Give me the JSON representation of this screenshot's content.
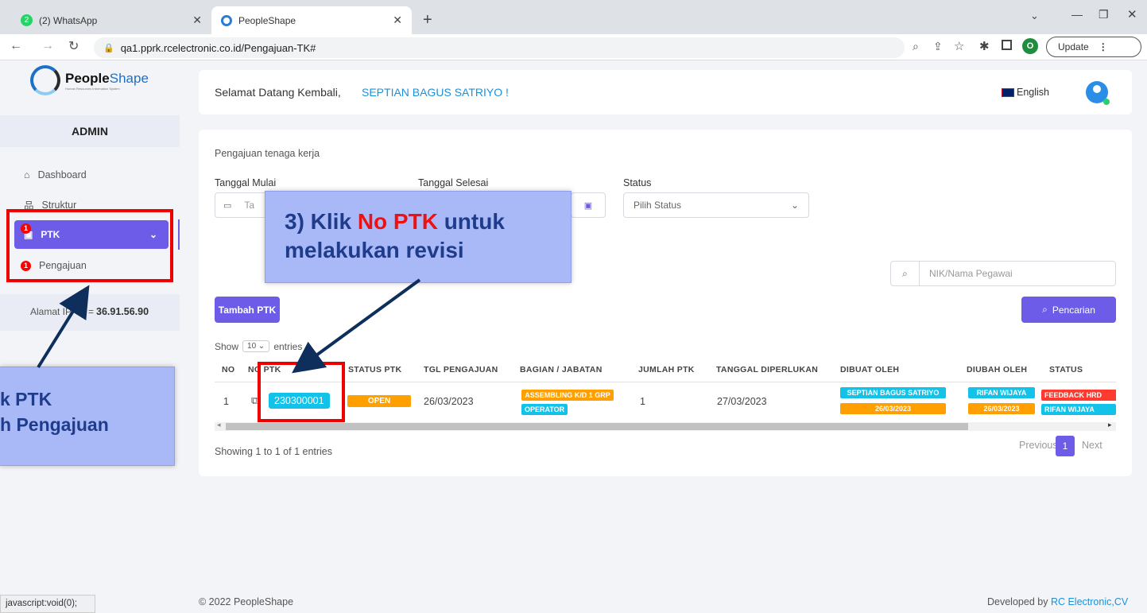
{
  "browser": {
    "tabs": [
      {
        "label": "(2) WhatsApp",
        "badge": "2"
      },
      {
        "label": "PeopleShape"
      }
    ],
    "url": "qa1.pprk.rcelectronic.co.id/Pengajuan-TK#",
    "update_label": "Update",
    "profile_initial": "O"
  },
  "sidebar": {
    "brand_bold": "People",
    "brand_light": "Shape",
    "brand_sub": "Human Resources Information System",
    "role": "ADMIN",
    "items": [
      {
        "label": "Dashboard"
      },
      {
        "label": "Struktur"
      },
      {
        "label": "PTK",
        "badge": "1"
      },
      {
        "label": "Pengajuan",
        "badge": "1"
      }
    ],
    "ip_label": "Alamat IP",
    "ip_eq": "=",
    "ip_value": "36.91.56.90"
  },
  "header": {
    "welcome": "Selamat Datang Kembali,",
    "user": "SEPTIAN BAGUS SATRIYO !",
    "language": "English"
  },
  "content": {
    "section_title": "Pengajuan tenaga kerja",
    "filters": {
      "start_label": "Tanggal Mulai",
      "start_placeholder": "Ta",
      "end_label": "Tanggal Selesai",
      "status_label": "Status",
      "status_value": "Pilih Status"
    },
    "search_placeholder": "NIK/Nama Pegawai",
    "add_button": "Tambah PTK",
    "search_button": "Pencarian",
    "show_label": "Show",
    "show_value": "10",
    "entries_label": "entries",
    "columns": [
      "NO",
      "NO PTK",
      "STATUS PTK",
      "TGL PENGAJUAN",
      "BAGIAN / JABATAN",
      "JUMLAH PTK",
      "TANGGAL DIPERLUKAN",
      "DIBUAT OLEH",
      "DIUBAH OLEH",
      "STATUS"
    ],
    "row": {
      "no": "1",
      "ptk": "230300001",
      "status_ptk": "OPEN",
      "tgl": "26/03/2023",
      "bagian": "ASSEMBLING K/D 1 GRP",
      "jabatan": "OPERATOR",
      "jumlah": "1",
      "diperlukan": "27/03/2023",
      "dibuat_nama": "SEPTIAN BAGUS SATRIYO",
      "dibuat_tgl": "26/03/2023",
      "diubah_nama": "RIFAN WIJAYA",
      "diubah_tgl": "26/03/2023",
      "status1": "FEEDBACK HRD",
      "status2": "RIFAN WIJAYA"
    },
    "info": "Showing 1 to 1 of 1 entries",
    "prev": "Previous",
    "page": "1",
    "next": "Next"
  },
  "footer": {
    "copyright": "© 2022 PeopleShape",
    "dev_prefix": "Developed by",
    "dev_name": "RC Electronic,CV",
    "statusbar": "javascript:void(0);"
  },
  "annotations": {
    "callout_main_1": "3) Klik",
    "callout_main_red": "No PTK",
    "callout_main_2": "untuk",
    "callout_main_3": "melakukan revisi",
    "callout_left_1": "k PTK",
    "callout_left_2": "h Pengajuan"
  },
  "colors": {
    "accent": "#6c5ce7",
    "cyan": "#12c2e9",
    "orange": "#ffa000",
    "red": "#ff3b30",
    "annotation_red": "#ee0000",
    "callout_bg": "#a9b9f7"
  }
}
